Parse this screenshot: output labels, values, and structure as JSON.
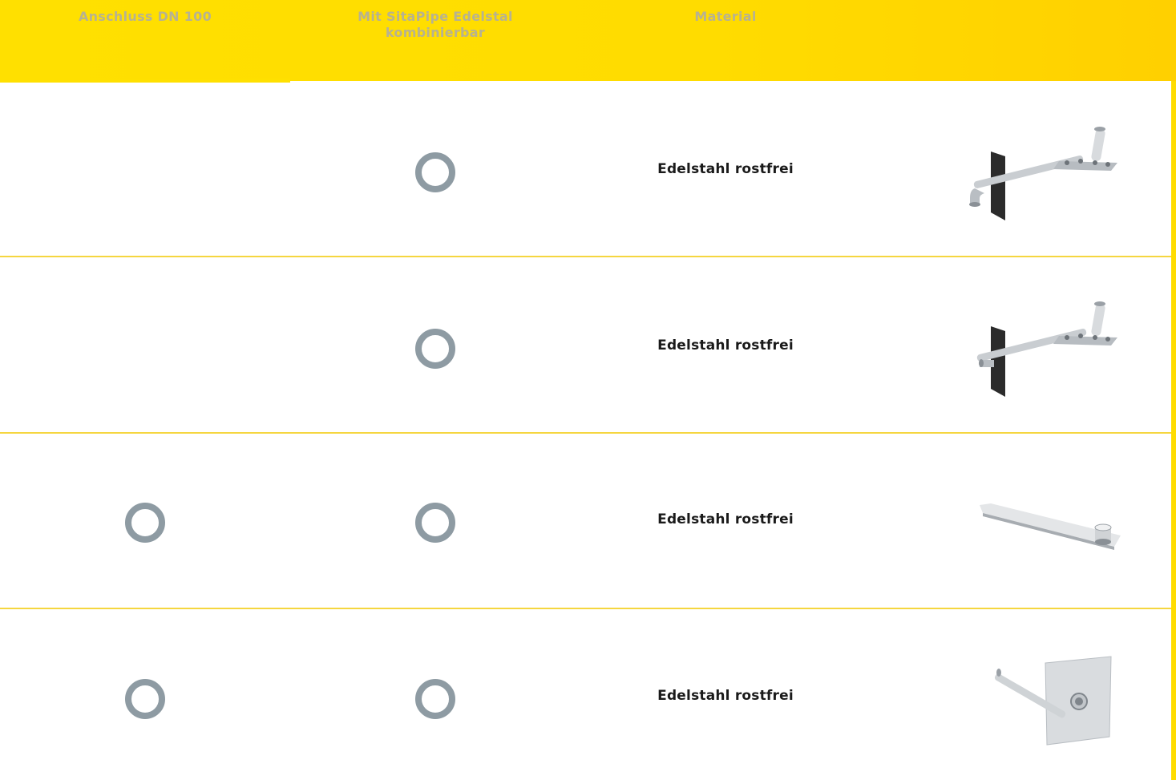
{
  "header": {
    "columns": [
      {
        "line1": "Anschluss DN 100",
        "line2": ""
      },
      {
        "line1": "Mit SitaPipe Edelstal",
        "line2": "kombinierbar"
      },
      {
        "line1": "Material",
        "line2": ""
      }
    ]
  },
  "rows": [
    {
      "dn100": false,
      "sitapipe": true,
      "material": "Edelstahl rostfrei",
      "product": "drain-pipe-bent-icon"
    },
    {
      "dn100": false,
      "sitapipe": true,
      "material": "Edelstahl rostfrei",
      "product": "drain-pipe-straight-icon"
    },
    {
      "dn100": true,
      "sitapipe": true,
      "material": "Edelstahl rostfrei",
      "product": "flat-channel-drain-icon"
    },
    {
      "dn100": true,
      "sitapipe": true,
      "material": "Edelstahl rostfrei",
      "product": "wall-plate-drain-icon"
    }
  ],
  "colors": {
    "header": "#ffe000",
    "ring": "#8e9ba3",
    "divider": "#f5d640"
  }
}
